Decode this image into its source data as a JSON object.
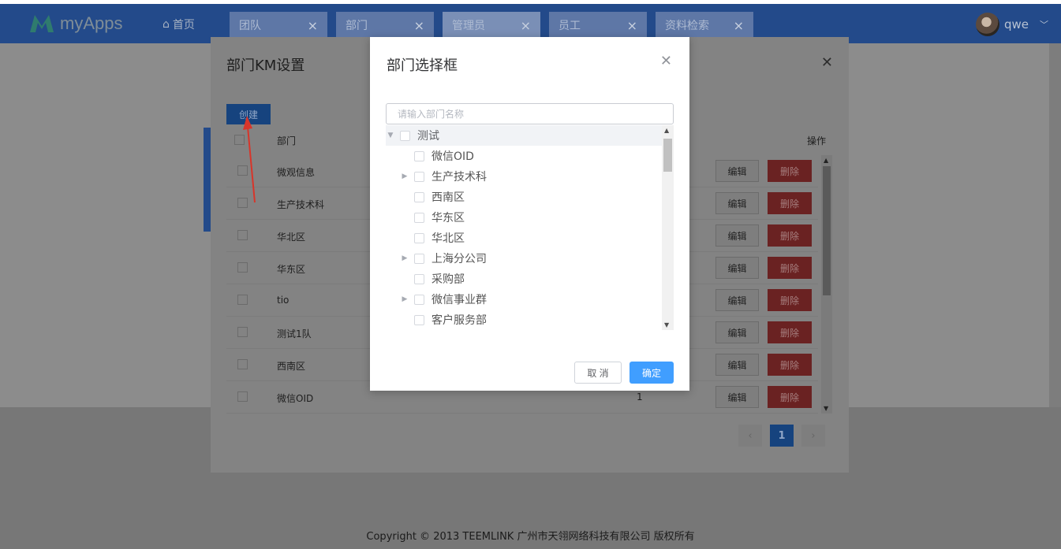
{
  "brand": {
    "name": "myApps"
  },
  "nav": {
    "home": "首页",
    "tabs": [
      {
        "label": "团队",
        "active": false
      },
      {
        "label": "部门",
        "active": false
      },
      {
        "label": "管理员",
        "active": true
      },
      {
        "label": "员工",
        "active": false
      },
      {
        "label": "资料检索",
        "active": false
      }
    ],
    "user": "qwe"
  },
  "km_modal": {
    "title": "部门KM设置",
    "create_label": "创建",
    "columns": {
      "name": "部门",
      "op": "操作"
    },
    "rows": [
      {
        "name": "微观信息",
        "num": ""
      },
      {
        "name": "生产技术科",
        "num": ""
      },
      {
        "name": "华北区",
        "num": ""
      },
      {
        "name": "华东区",
        "num": ""
      },
      {
        "name": "tio",
        "num": ""
      },
      {
        "name": "测试1队",
        "num": ""
      },
      {
        "name": "西南区",
        "num": ""
      },
      {
        "name": "微信OID",
        "num": "1"
      }
    ],
    "edit_label": "编辑",
    "delete_label": "删除",
    "pager": {
      "prev": "‹",
      "current": "1",
      "next": "›"
    }
  },
  "dialog": {
    "title": "部门选择框",
    "search_placeholder": "请输入部门名称",
    "tree": [
      {
        "label": "测试",
        "level": 0,
        "expanded": true
      },
      {
        "label": "微信OID",
        "level": 1,
        "has_children": false
      },
      {
        "label": "生产技术科",
        "level": 1,
        "has_children": true
      },
      {
        "label": "西南区",
        "level": 1,
        "has_children": false
      },
      {
        "label": "华东区",
        "level": 1,
        "has_children": false
      },
      {
        "label": "华北区",
        "level": 1,
        "has_children": false
      },
      {
        "label": "上海分公司",
        "level": 1,
        "has_children": true
      },
      {
        "label": "采购部",
        "level": 1,
        "has_children": false
      },
      {
        "label": "微信事业群",
        "level": 1,
        "has_children": true
      },
      {
        "label": "客户服务部",
        "level": 1,
        "has_children": false
      }
    ],
    "cancel_label": "取 消",
    "ok_label": "确定"
  },
  "footer": {
    "copyright": "Copyright © 2013 TEEMLINK 广州市天翎网络科技有限公司 版权所有"
  },
  "colors": {
    "navbar": "#234a8a",
    "primary": "#409eff",
    "danger": "#d9534f"
  }
}
